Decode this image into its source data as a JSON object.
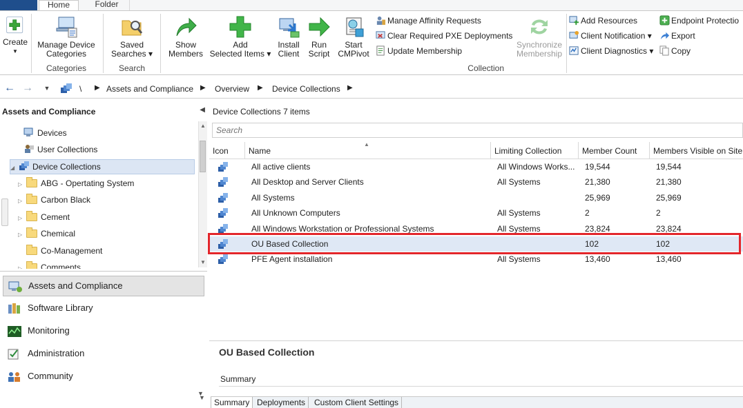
{
  "ribbon_tabs": {
    "home": "Home",
    "folder": "Folder"
  },
  "ribbon": {
    "create": "Create",
    "manage_device_categories": [
      "Manage Device",
      "Categories"
    ],
    "saved_searches": [
      "Saved",
      "Searches ▾"
    ],
    "show_members": [
      "Show",
      "Members"
    ],
    "add_selected_items": [
      "Add",
      "Selected Items ▾"
    ],
    "install_client": [
      "Install",
      "Client"
    ],
    "run_script": [
      "Run",
      "Script"
    ],
    "start_cmpivot": [
      "Start",
      "CMPivot"
    ],
    "manage_affinity_requests": "Manage Affinity Requests",
    "clear_required_pxe": "Clear Required PXE Deployments",
    "update_membership": "Update Membership",
    "synchronize_membership": [
      "Synchronize",
      "Membership"
    ],
    "add_resources": "Add Resources",
    "client_notification": "Client Notification ▾",
    "client_diagnostics": "Client Diagnostics ▾",
    "endpoint_protection": "Endpoint Protectio",
    "export": "Export",
    "copy": "Copy",
    "groups": {
      "categories": "Categories",
      "search": "Search",
      "collection": "Collection"
    }
  },
  "address_bar": {
    "root": "\\",
    "crumbs": [
      "Assets and Compliance",
      "Overview",
      "Device Collections"
    ]
  },
  "nav": {
    "header": "Assets and Compliance",
    "tree": [
      {
        "label": "Devices"
      },
      {
        "label": "User Collections"
      },
      {
        "label": "Device Collections"
      },
      {
        "label": "ABG - Opertating System"
      },
      {
        "label": "Carbon Black"
      },
      {
        "label": "Cement"
      },
      {
        "label": "Chemical"
      },
      {
        "label": "Co-Management"
      },
      {
        "label": "Comments"
      }
    ],
    "workspaces": [
      {
        "label": "Assets and Compliance"
      },
      {
        "label": "Software Library"
      },
      {
        "label": "Monitoring"
      },
      {
        "label": "Administration"
      },
      {
        "label": "Community"
      }
    ]
  },
  "main": {
    "title": "Device Collections",
    "count_label": "7 items",
    "search_placeholder": "Search",
    "columns": [
      "Icon",
      "Name",
      "Limiting Collection",
      "Member Count",
      "Members Visible on Site"
    ],
    "rows": [
      {
        "name": "All active clients",
        "limiting": "All Windows Works...",
        "count": "19,544",
        "visible": "19,544"
      },
      {
        "name": "All Desktop and Server Clients",
        "limiting": "All Systems",
        "count": "21,380",
        "visible": "21,380"
      },
      {
        "name": "All Systems",
        "limiting": "",
        "count": "25,969",
        "visible": "25,969"
      },
      {
        "name": "All Unknown Computers",
        "limiting": "All Systems",
        "count": "2",
        "visible": "2"
      },
      {
        "name": "All Windows Workstation or Professional Systems",
        "limiting": "All Systems",
        "count": "23,824",
        "visible": "23,824"
      },
      {
        "name": "OU Based Collection",
        "limiting": "",
        "count": "102",
        "visible": "102"
      },
      {
        "name": "PFE Agent installation",
        "limiting": "All Systems",
        "count": "13,460",
        "visible": "13,460"
      }
    ]
  },
  "details": {
    "title": "OU Based Collection",
    "summary_heading": "Summary",
    "tabs": [
      "Summary",
      "Deployments",
      "Custom Client Settings"
    ]
  },
  "colors": {
    "highlight": "#e3262b",
    "selection": "#dfe8f5",
    "accent": "#1f4e8c"
  }
}
